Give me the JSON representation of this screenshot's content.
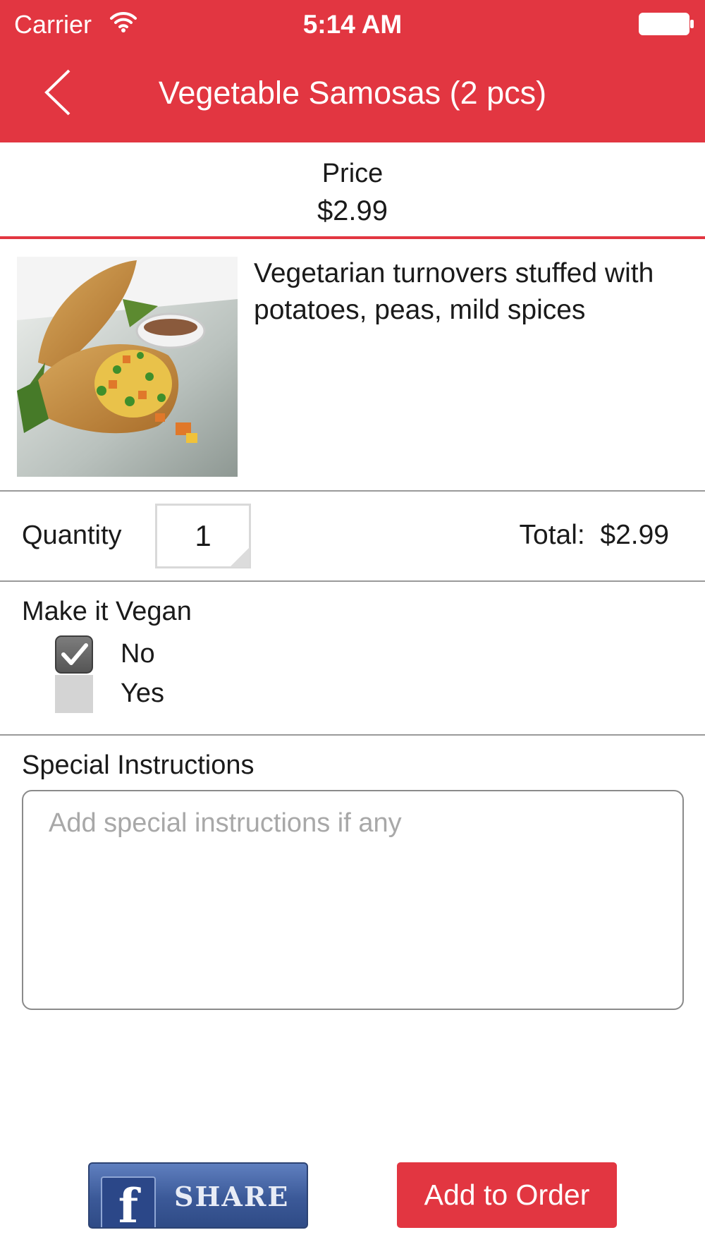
{
  "status_bar": {
    "carrier": "Carrier",
    "time": "5:14 AM"
  },
  "nav": {
    "title": "Vegetable Samosas (2 pcs)",
    "back_icon": "chevron-left-icon"
  },
  "price": {
    "label": "Price",
    "value": "$2.99"
  },
  "product": {
    "image": "vegetable-samosa-photo",
    "description": "Vegetarian turnovers stuffed with potatoes, peas, mild spices"
  },
  "quantity": {
    "label": "Quantity",
    "value": "1",
    "total_label": "Total:",
    "total_value": "$2.99"
  },
  "vegan": {
    "label": "Make it Vegan",
    "options": [
      {
        "label": "No",
        "checked": true
      },
      {
        "label": "Yes",
        "checked": false
      }
    ]
  },
  "instructions": {
    "label": "Special Instructions",
    "placeholder": "Add special instructions if any"
  },
  "actions": {
    "share_label": "SHARE",
    "share_logo": "f",
    "add_label": "Add to Order"
  },
  "colors": {
    "accent": "#e23641",
    "facebook": "#3b5998"
  }
}
